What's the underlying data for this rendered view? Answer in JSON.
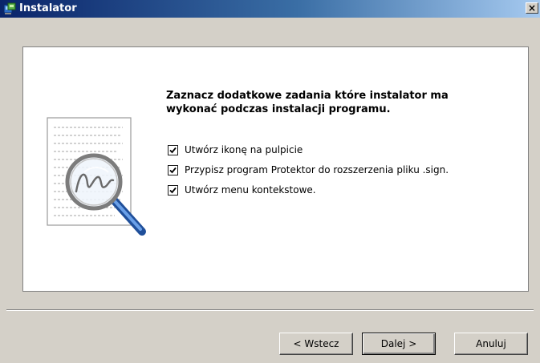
{
  "window": {
    "title": "Instalator",
    "close_label": "×"
  },
  "content": {
    "heading_line1": "Zaznacz dodatkowe zadania które instalator ma",
    "heading_line2": "wykonać podczas instalacji programu.",
    "options": [
      {
        "label": "Utwórz ikonę na pulpicie",
        "checked": true
      },
      {
        "label": "Przypisz program Protektor do rozszerzenia pliku .sign.",
        "checked": true
      },
      {
        "label": "Utwórz menu kontekstowe.",
        "checked": true
      }
    ]
  },
  "buttons": {
    "back": "< Wstecz",
    "next": "Dalej >",
    "cancel": "Anuluj"
  },
  "colors": {
    "titlebar_start": "#0a246a",
    "titlebar_end": "#a6caf0",
    "face": "#d4d0c8",
    "panel": "#ffffff"
  },
  "icons": {
    "app": "installer-icon",
    "illustration": "magnifier-document-icon",
    "close": "close-icon"
  }
}
